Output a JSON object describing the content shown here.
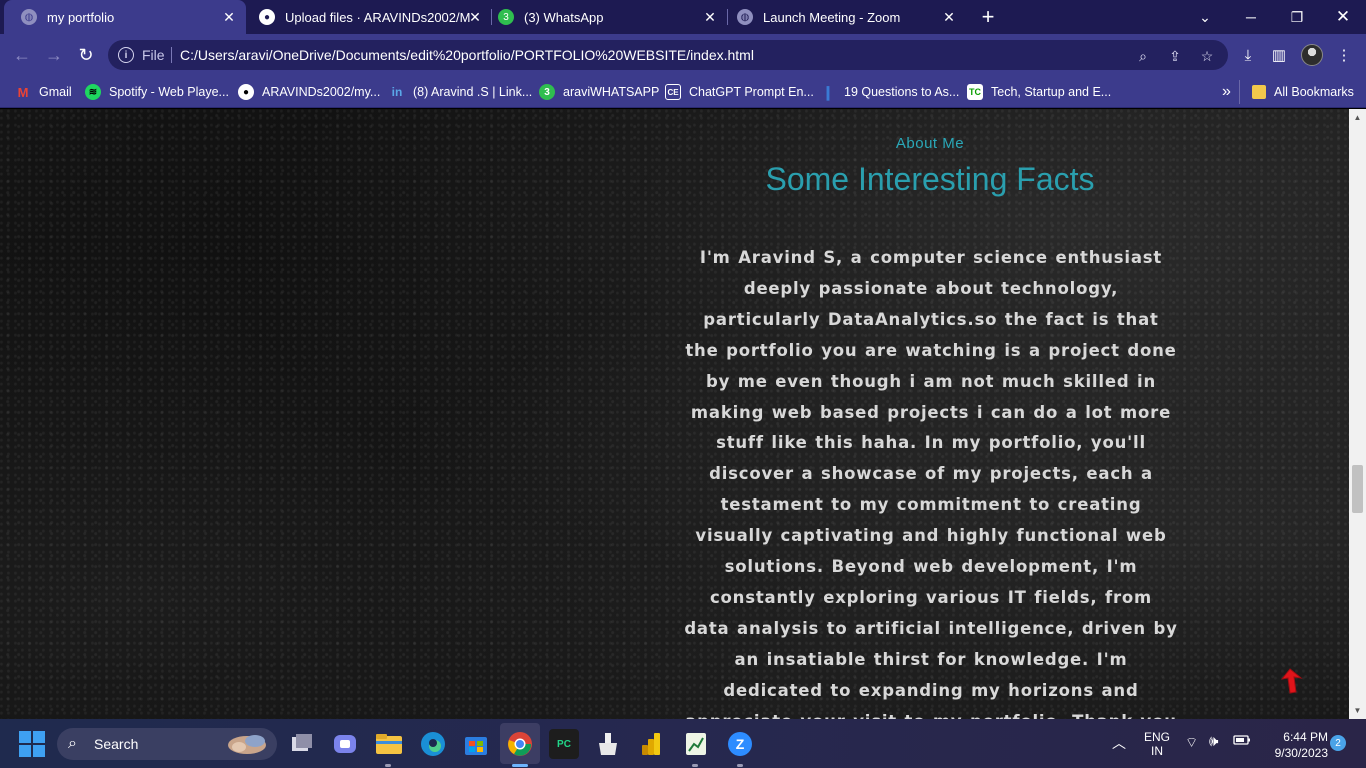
{
  "browser": {
    "tabs": [
      {
        "title": "my portfolio",
        "active": true,
        "icon": "globe-icon"
      },
      {
        "title": "Upload files · ARAVINDs2002/M",
        "active": false,
        "icon": "github-icon"
      },
      {
        "title": "(3) WhatsApp",
        "active": false,
        "icon": "whatsapp-icon",
        "badge": "3"
      },
      {
        "title": "Launch Meeting - Zoom",
        "active": false,
        "icon": "globe-icon"
      }
    ],
    "address": {
      "scheme": "File",
      "url": "C:/Users/aravi/OneDrive/Documents/edit%20portfolio/PORTFOLIO%20WEBSITE/index.html"
    },
    "bookmarks": [
      {
        "label": "Gmail",
        "icon": "gmail-icon"
      },
      {
        "label": "Spotify - Web Playe...",
        "icon": "spotify-icon"
      },
      {
        "label": "ARAVINDs2002/my...",
        "icon": "github-icon"
      },
      {
        "label": "(8) Aravind .S | Link...",
        "icon": "linkedin-icon"
      },
      {
        "label": "araviWHATSAPP",
        "icon": "whatsapp-icon"
      },
      {
        "label": "ChatGPT Prompt En...",
        "icon": "chatgpt-icon"
      },
      {
        "label": "19 Questions to As...",
        "icon": "bookmark-icon"
      },
      {
        "label": "Tech, Startup and E...",
        "icon": "techcrunch-icon"
      }
    ],
    "bookmarks_overflow": "»",
    "all_bookmarks": "All Bookmarks"
  },
  "page": {
    "section_label": "About Me",
    "section_title": "Some Interesting Facts",
    "body_text": "I'm Aravind S, a computer science enthusiast deeply passionate about technology, particularly DataAnalytics.so the fact is that the portfolio you are watching is a project done by me even though i am not much skilled in making web based projects i can do a lot more stuff like this haha. In my portfolio, you'll discover a showcase of my projects, each a testament to my commitment to creating visually captivating and highly functional web solutions. Beyond web development, I'm constantly exploring various IT fields, from data analysis to artificial intelligence, driven by an insatiable thirst for knowledge. I'm dedicated to expanding my horizons and appreciate your visit to my portfolio. Thank you for exploring my work.It",
    "accent_color": "#2aa8b8",
    "scroll_top_icon": "arrow-up-icon"
  },
  "taskbar": {
    "search_placeholder": "Search",
    "lang_primary": "ENG",
    "lang_secondary": "IN",
    "time": "6:44 PM",
    "date": "9/30/2023",
    "notification_count": "2"
  }
}
